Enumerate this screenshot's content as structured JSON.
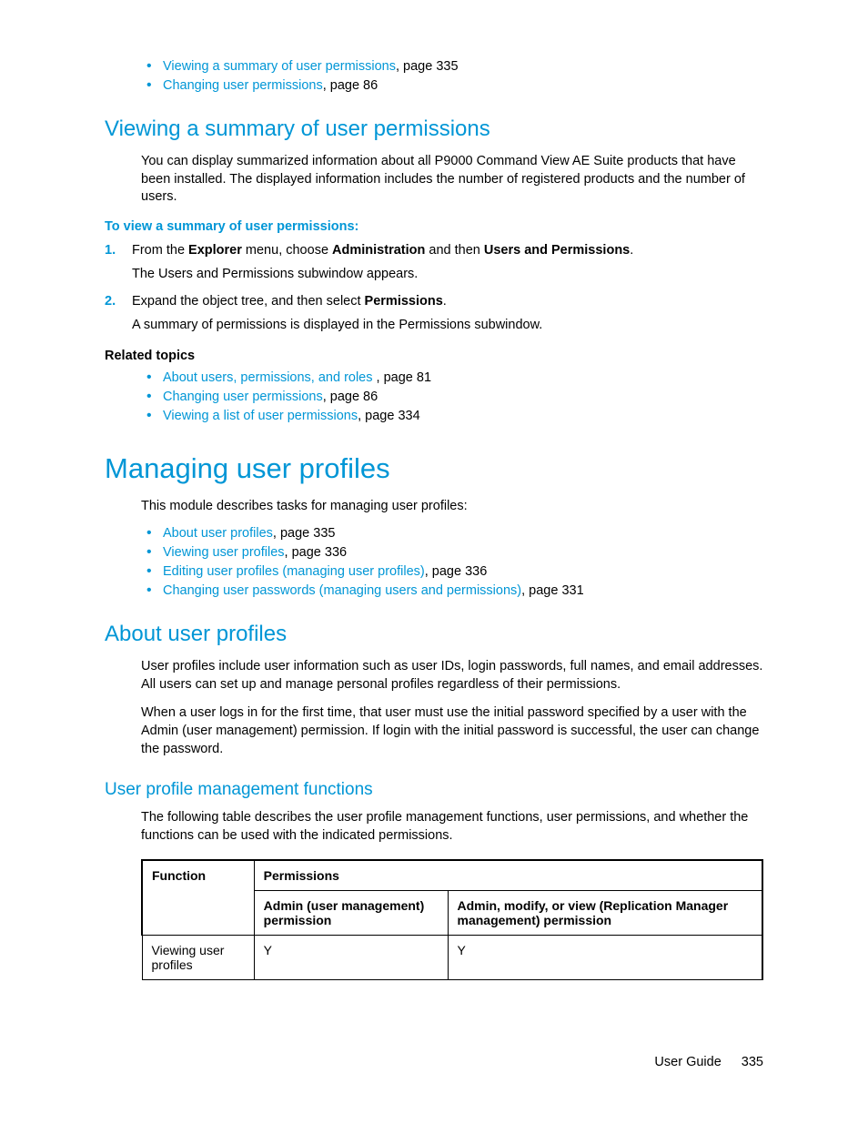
{
  "top_links": [
    {
      "text": "Viewing a summary of user permissions",
      "suffix": ", page 335"
    },
    {
      "text": "Changing user permissions",
      "suffix": ", page 86"
    }
  ],
  "section_viewing": {
    "heading": "Viewing a summary of user permissions",
    "intro": "You can display summarized information about all P9000 Command View AE Suite products that have been installed. The displayed information includes the number of registered products and the number of users.",
    "proc_title": "To view a summary of user permissions:",
    "step1_prefix": "From the ",
    "step1_b1": "Explorer",
    "step1_mid1": " menu, choose ",
    "step1_b2": "Administration",
    "step1_mid2": " and then ",
    "step1_b3": "Users and Permissions",
    "step1_suffix": ".",
    "step1_body": "The Users and Permissions subwindow appears.",
    "step2_prefix": "Expand the object tree, and then select ",
    "step2_b1": "Permissions",
    "step2_suffix": ".",
    "step2_body": "A summary of permissions is displayed in the Permissions subwindow.",
    "related_heading": "Related topics",
    "related": [
      {
        "text": "About users, permissions, and roles ",
        "suffix": ", page 81"
      },
      {
        "text": "Changing user permissions",
        "suffix": ", page 86"
      },
      {
        "text": "Viewing a list of user permissions",
        "suffix": ", page 334"
      }
    ]
  },
  "section_manage": {
    "heading": "Managing user profiles",
    "intro": "This module describes tasks for managing user profiles:",
    "links": [
      {
        "text": "About user profiles",
        "suffix": ", page 335"
      },
      {
        "text": "Viewing user profiles",
        "suffix": ", page 336"
      },
      {
        "text": "Editing user profiles (managing user profiles)",
        "suffix": ", page 336"
      },
      {
        "text": "Changing user passwords (managing users and permissions)",
        "suffix": ", page 331"
      }
    ]
  },
  "section_about": {
    "heading": "About user profiles",
    "p1": "User profiles include user information such as user IDs, login passwords, full names, and email addresses. All users can set up and manage personal profiles regardless of their permissions.",
    "p2": "When a user logs in for the first time, that user must use the initial password specified by a user with the Admin (user management) permission. If login with the initial password is successful, the user can change the password."
  },
  "section_funcs": {
    "heading": "User profile management functions",
    "intro": "The following table describes the user profile management functions, user permissions, and whether the functions can be used with the indicated permissions.",
    "table": {
      "col_function": "Function",
      "col_permissions": "Permissions",
      "col_admin": "Admin (user management) permission",
      "col_replic": "Admin, modify, or view (Replication Manager management) permission",
      "row1_func": "Viewing user profiles",
      "row1_admin": "Y",
      "row1_replic": "Y"
    }
  },
  "footer": {
    "label": "User Guide",
    "page": "335"
  }
}
